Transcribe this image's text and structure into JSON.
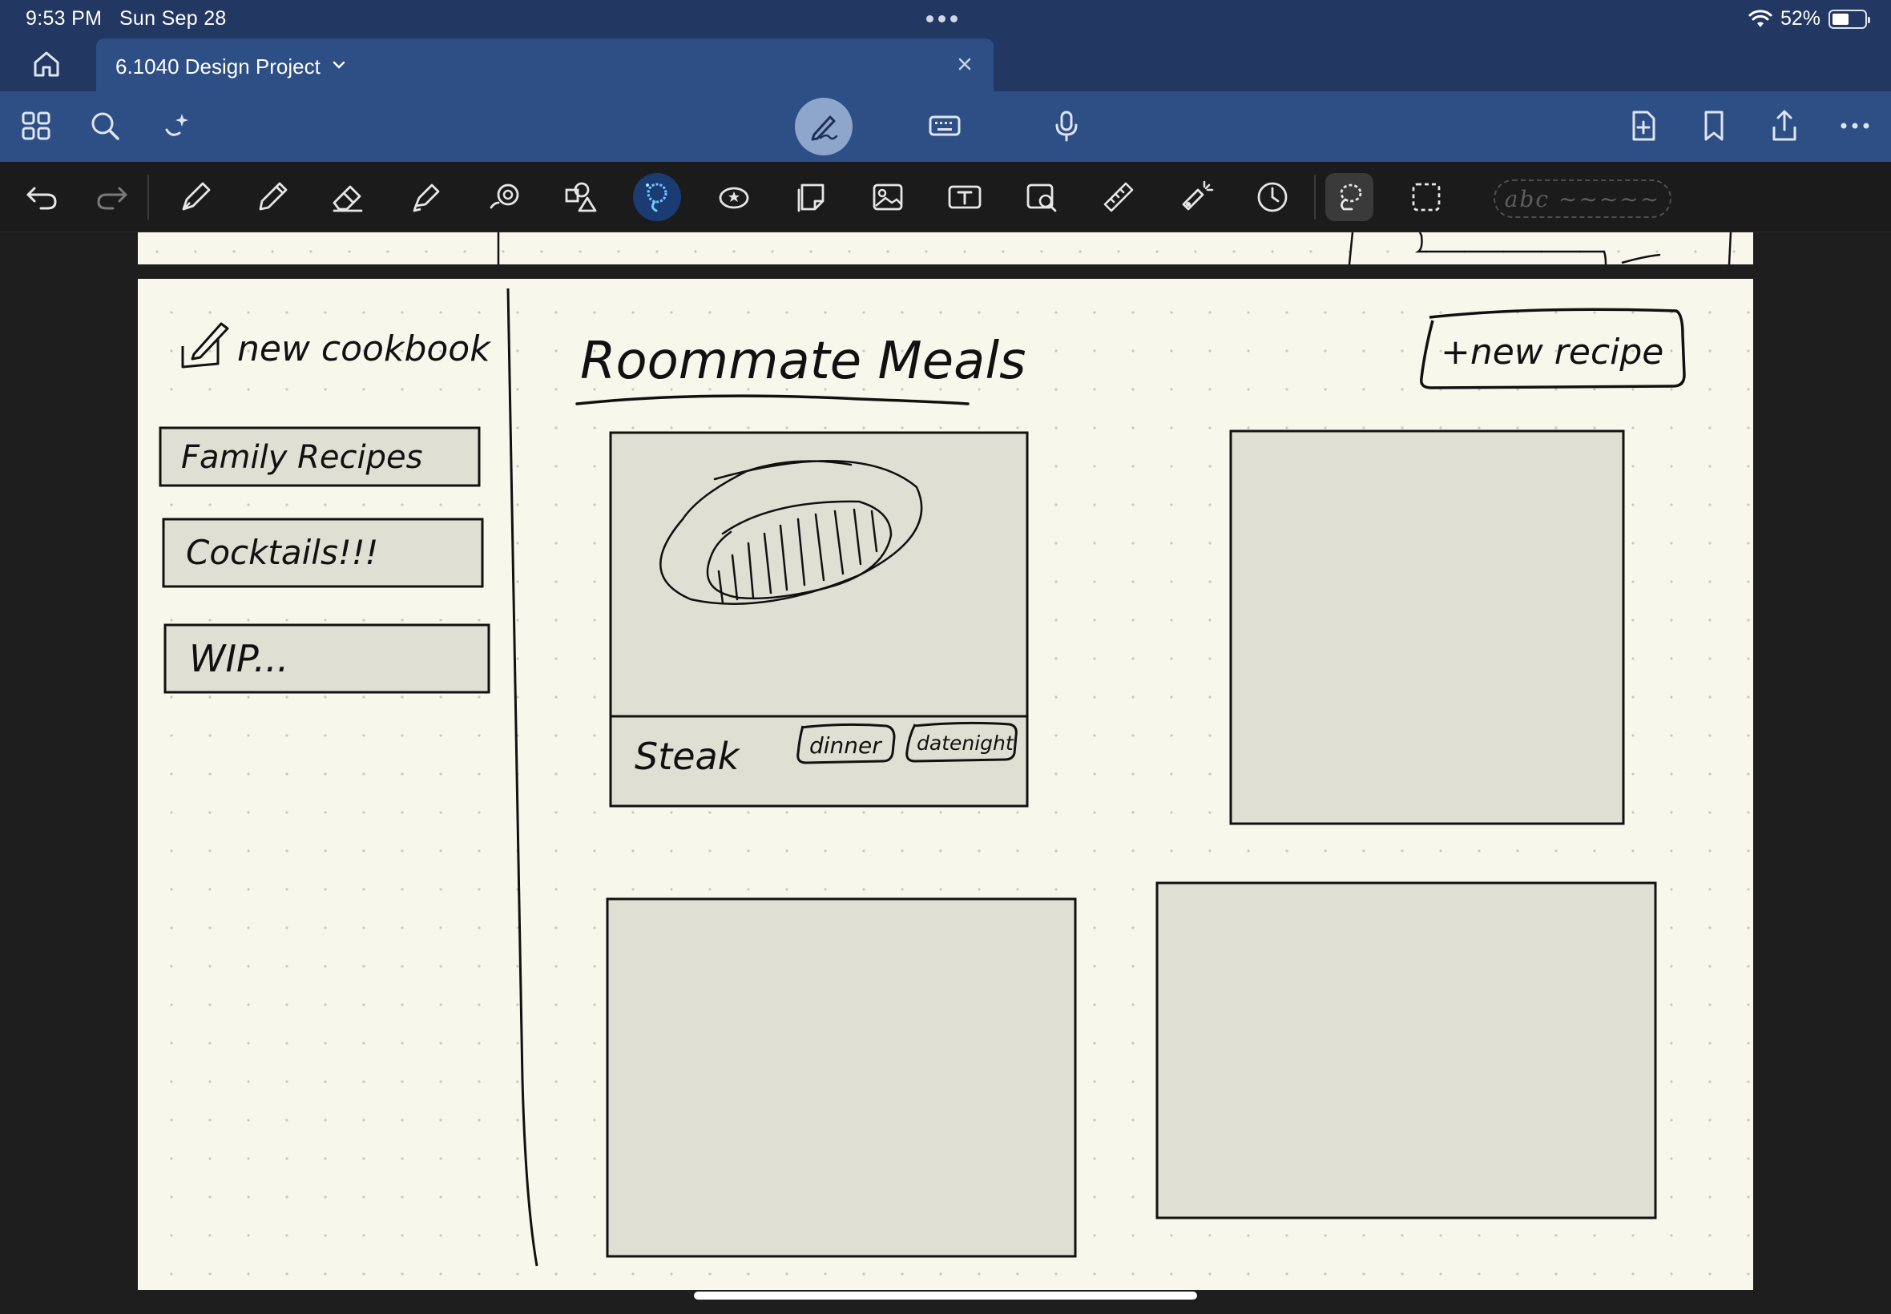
{
  "status_bar": {
    "time": "9:53 PM",
    "date": "Sun Sep 28",
    "battery": "52%",
    "battery_level": 0.52
  },
  "tab": {
    "title": "6.1040 Design Project"
  },
  "tools": {
    "text_style_sample": "abc ~~~~~"
  },
  "sketch": {
    "new_cookbook_label": "new cookbook",
    "cookbooks": [
      "Family Recipes",
      "Cocktails!!!",
      "WIP..."
    ],
    "page_title": "Roommate Meals",
    "new_recipe_button": "+new recipe",
    "recipe_card": {
      "name": "Steak",
      "tags": [
        "dinner",
        "datenight"
      ]
    }
  },
  "colors": {
    "status_bar_bg": "#223761",
    "toolbar_bg": "#2d4f86",
    "paper": "#f8f7ec",
    "card_fill": "#e0dfd3",
    "ink": "#111111"
  }
}
